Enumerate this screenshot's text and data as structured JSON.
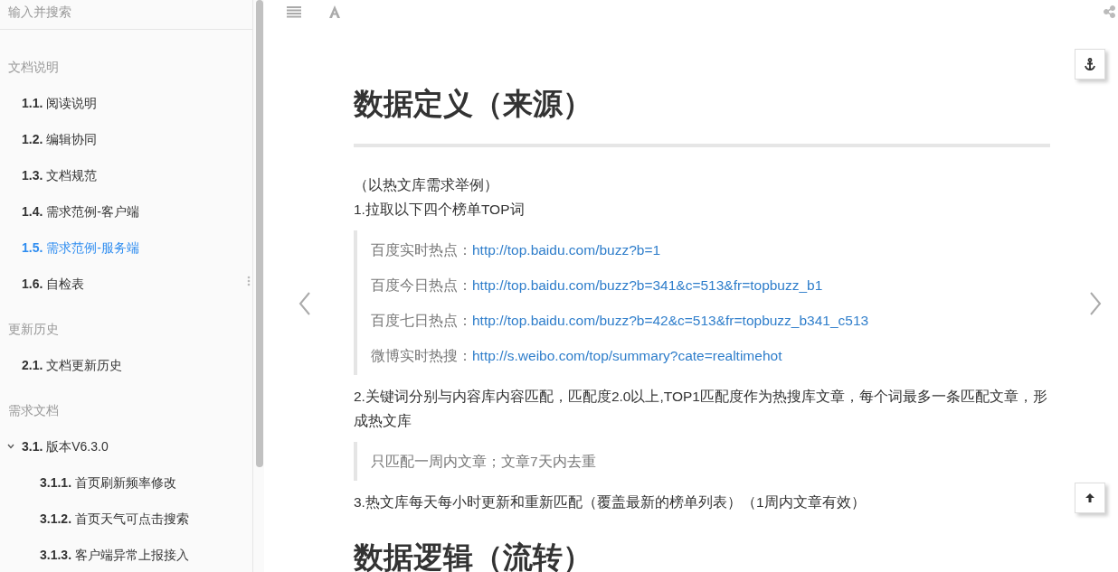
{
  "search": {
    "placeholder": "输入并搜索"
  },
  "sidebar": {
    "sections": [
      {
        "header": "文档说明",
        "items": [
          {
            "number": "1.1.",
            "label": "阅读说明",
            "selected": false
          },
          {
            "number": "1.2.",
            "label": "编辑协同",
            "selected": false
          },
          {
            "number": "1.3.",
            "label": "文档规范",
            "selected": false
          },
          {
            "number": "1.4.",
            "label": "需求范例-客户端",
            "selected": false
          },
          {
            "number": "1.5.",
            "label": "需求范例-服务端",
            "selected": true
          },
          {
            "number": "1.6.",
            "label": "自检表",
            "selected": false
          }
        ]
      },
      {
        "header": "更新历史",
        "items": [
          {
            "number": "2.1.",
            "label": "文档更新历史",
            "selected": false
          }
        ]
      },
      {
        "header": "需求文档",
        "items": [
          {
            "number": "3.1.",
            "label": "版本V6.3.0",
            "selected": false,
            "expanded": true,
            "children": [
              {
                "number": "3.1.1.",
                "label": "首页刷新频率修改",
                "selected": false
              },
              {
                "number": "3.1.2.",
                "label": "首页天气可点击搜索",
                "selected": false
              },
              {
                "number": "3.1.3.",
                "label": "客户端异常上报接入",
                "selected": false
              }
            ]
          }
        ]
      }
    ]
  },
  "content": {
    "title": "数据定义（来源）",
    "blocks": [
      {
        "kind": "paragraph",
        "text": "（以热文库需求举例）"
      },
      {
        "kind": "paragraph",
        "text": "1.拉取以下四个榜单TOP词"
      },
      {
        "kind": "quote",
        "lines": [
          {
            "label": "百度实时热点：",
            "link": "http://top.baidu.com/buzz?b=1"
          },
          {
            "label": "百度今日热点：",
            "link": "http://top.baidu.com/buzz?b=341&c=513&fr=topbuzz_b1"
          },
          {
            "label": "百度七日热点：",
            "link": "http://top.baidu.com/buzz?b=42&c=513&fr=topbuzz_b341_c513"
          },
          {
            "label": "微博实时热搜：",
            "link": "http://s.weibo.com/top/summary?cate=realtimehot"
          }
        ]
      },
      {
        "kind": "paragraph",
        "text": "2.关键词分别与内容库内容匹配，匹配度2.0以上,TOP1匹配度作为热搜库文章，每个词最多一条匹配文章，形成热文库"
      },
      {
        "kind": "quote",
        "lines": [
          {
            "label": "只匹配一周内文章；文章7天内去重"
          }
        ]
      },
      {
        "kind": "paragraph",
        "text": "3.热文库每天每小时更新和重新匹配（覆盖最新的榜单列表）（1周内文章有效）"
      },
      {
        "kind": "heading",
        "text": "数据逻辑（流转）"
      }
    ]
  }
}
